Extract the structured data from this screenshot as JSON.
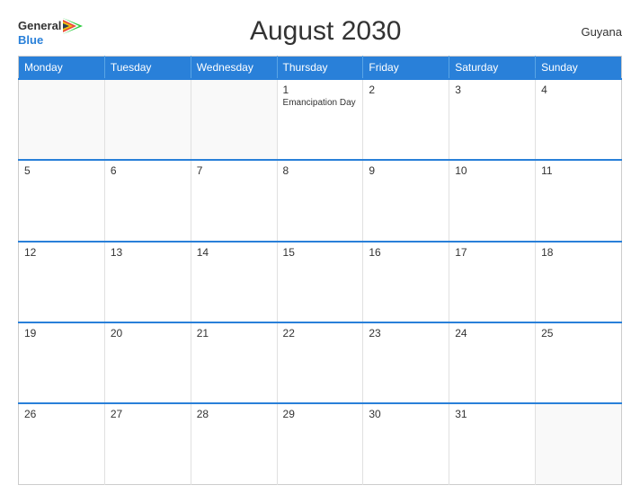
{
  "header": {
    "logo_general": "General",
    "logo_blue": "Blue",
    "title": "August 2030",
    "country": "Guyana"
  },
  "days_of_week": [
    "Monday",
    "Tuesday",
    "Wednesday",
    "Thursday",
    "Friday",
    "Saturday",
    "Sunday"
  ],
  "weeks": [
    [
      {
        "num": "",
        "event": ""
      },
      {
        "num": "",
        "event": ""
      },
      {
        "num": "",
        "event": ""
      },
      {
        "num": "1",
        "event": "Emancipation Day"
      },
      {
        "num": "2",
        "event": ""
      },
      {
        "num": "3",
        "event": ""
      },
      {
        "num": "4",
        "event": ""
      }
    ],
    [
      {
        "num": "5",
        "event": ""
      },
      {
        "num": "6",
        "event": ""
      },
      {
        "num": "7",
        "event": ""
      },
      {
        "num": "8",
        "event": ""
      },
      {
        "num": "9",
        "event": ""
      },
      {
        "num": "10",
        "event": ""
      },
      {
        "num": "11",
        "event": ""
      }
    ],
    [
      {
        "num": "12",
        "event": ""
      },
      {
        "num": "13",
        "event": ""
      },
      {
        "num": "14",
        "event": ""
      },
      {
        "num": "15",
        "event": ""
      },
      {
        "num": "16",
        "event": ""
      },
      {
        "num": "17",
        "event": ""
      },
      {
        "num": "18",
        "event": ""
      }
    ],
    [
      {
        "num": "19",
        "event": ""
      },
      {
        "num": "20",
        "event": ""
      },
      {
        "num": "21",
        "event": ""
      },
      {
        "num": "22",
        "event": ""
      },
      {
        "num": "23",
        "event": ""
      },
      {
        "num": "24",
        "event": ""
      },
      {
        "num": "25",
        "event": ""
      }
    ],
    [
      {
        "num": "26",
        "event": ""
      },
      {
        "num": "27",
        "event": ""
      },
      {
        "num": "28",
        "event": ""
      },
      {
        "num": "29",
        "event": ""
      },
      {
        "num": "30",
        "event": ""
      },
      {
        "num": "31",
        "event": ""
      },
      {
        "num": "",
        "event": ""
      }
    ]
  ]
}
